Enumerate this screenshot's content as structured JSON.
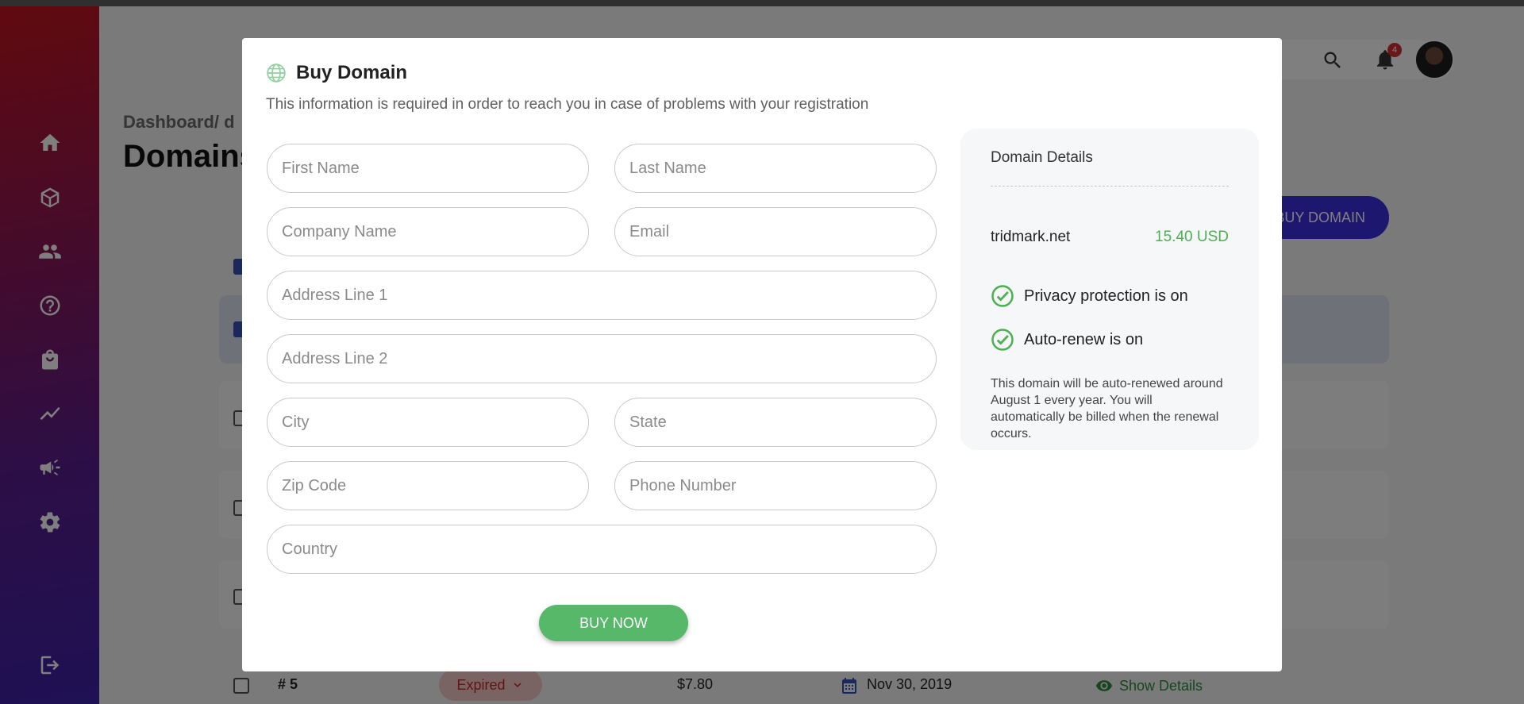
{
  "background": {
    "breadcrumb": "Dashboard/ d",
    "page_title": "Domains",
    "buy_domain_button": "BUY DOMAIN",
    "notification_count": "4",
    "row5": {
      "id": "# 5",
      "status": "Expired",
      "price": "$7.80",
      "date": "Nov 30, 2019",
      "action": "Show Details"
    }
  },
  "sidebar": {
    "items": [
      {
        "icon": "home-icon"
      },
      {
        "icon": "cube-icon"
      },
      {
        "icon": "users-icon"
      },
      {
        "icon": "help-icon"
      },
      {
        "icon": "shopping-bag-icon"
      },
      {
        "icon": "chart-line-icon"
      },
      {
        "icon": "megaphone-icon"
      },
      {
        "icon": "settings-icon"
      },
      {
        "icon": "logout-icon"
      }
    ]
  },
  "modal": {
    "title": "Buy Domain",
    "subtitle": "This information is required in order to reach you in case of problems with your registration",
    "fields": {
      "first_name": "First Name",
      "last_name": "Last Name",
      "company_name": "Company Name",
      "email": "Email",
      "address1": "Address Line 1",
      "address2": "Address Line 2",
      "city": "City",
      "state": "State",
      "zip": "Zip Code",
      "phone": "Phone Number",
      "country": "Country"
    },
    "buy_now": "BUY NOW",
    "details": {
      "title": "Domain Details",
      "domain": "tridmark.net",
      "price": "15.40 USD",
      "privacy": "Privacy protection is on",
      "autorenew": "Auto-renew is on",
      "note": "This domain will be auto-renewed around August 1 every year. You will automatically be billed when the renewal occurs."
    }
  },
  "colors": {
    "accent_green": "#56b868",
    "brand_blue": "#3c2fe0",
    "expired_red": "#c62828"
  }
}
